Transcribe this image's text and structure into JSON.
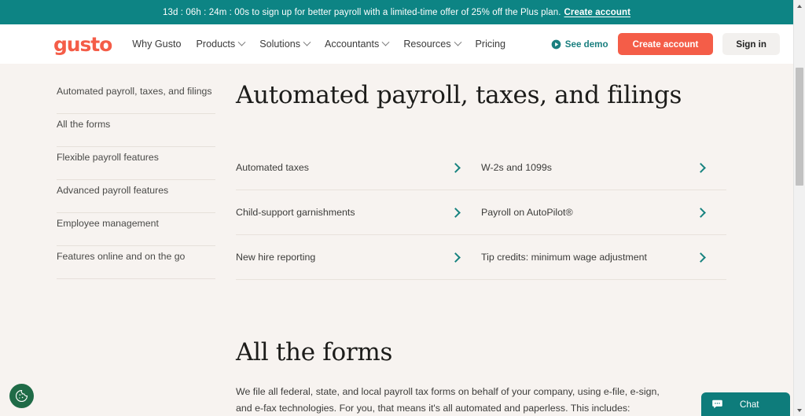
{
  "promo_banner": {
    "text": "13d : 06h : 24m : 00s to sign up for better payroll with a limited-time offer of 25% off the Plus plan.",
    "cta_label": "Create account",
    "background_color": "#0D8484"
  },
  "header": {
    "logo_text": "gusto",
    "logo_color": "#F45D48",
    "nav_items": [
      {
        "label": "Why Gusto",
        "has_dropdown": false
      },
      {
        "label": "Products",
        "has_dropdown": true
      },
      {
        "label": "Solutions",
        "has_dropdown": true
      },
      {
        "label": "Accountants",
        "has_dropdown": true
      },
      {
        "label": "Resources",
        "has_dropdown": true
      },
      {
        "label": "Pricing",
        "has_dropdown": false
      }
    ],
    "see_demo_label": "See demo",
    "see_demo_icon": "play-circle-icon",
    "create_account_label": "Create account",
    "sign_in_label": "Sign in",
    "accent_color": "#F45D48",
    "teal_color": "#1A7F7F"
  },
  "sidebar": {
    "items": [
      {
        "label": "Automated payroll, taxes, and filings"
      },
      {
        "label": "All the forms"
      },
      {
        "label": "Flexible payroll features"
      },
      {
        "label": "Advanced payroll features"
      },
      {
        "label": "Employee management"
      },
      {
        "label": "Features online and on the go"
      }
    ]
  },
  "main": {
    "section_title": "Automated payroll, taxes, and filings",
    "feature_links": [
      {
        "label": "Automated taxes",
        "icon": "chevron-right-icon"
      },
      {
        "label": "W-2s and 1099s",
        "icon": "chevron-right-icon"
      },
      {
        "label": "Child-support garnishments",
        "icon": "chevron-right-icon"
      },
      {
        "label": "Payroll on AutoPilot®",
        "icon": "chevron-right-icon"
      },
      {
        "label": "New hire reporting",
        "icon": "chevron-right-icon"
      },
      {
        "label": "Tip credits: minimum wage adjustment",
        "icon": "chevron-right-icon"
      }
    ],
    "forms_title": "All the forms",
    "forms_paragraph": "We file all federal, state, and local payroll tax forms on behalf of your company, using e-file, e-sign, and e-fax technologies. For you, that means it's all automated and paperless. This includes:"
  },
  "widgets": {
    "cookie_icon": "cookie-icon",
    "chat_label": "Chat",
    "chat_icon": "chat-bubble-icon",
    "chat_color": "#0E7C7B"
  }
}
